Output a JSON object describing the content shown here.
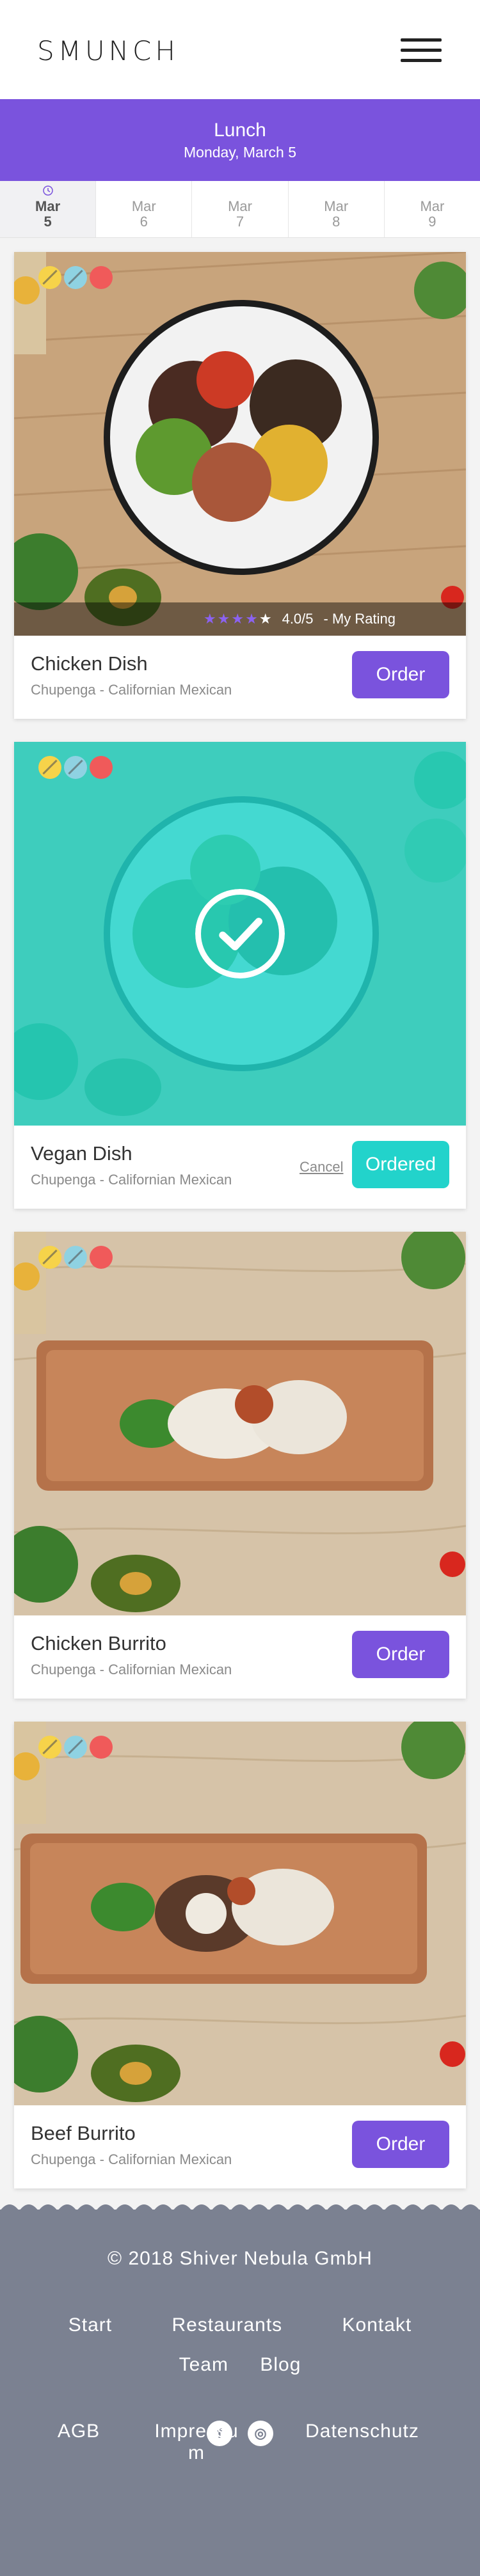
{
  "header": {
    "logo": "SMUNCH",
    "menu_icon": "hamburger-icon"
  },
  "banner": {
    "meal": "Lunch",
    "date": "Monday, March 5"
  },
  "tabs": [
    {
      "month": "Mar",
      "day": "5",
      "active": true
    },
    {
      "month": "Mar",
      "day": "6",
      "active": false
    },
    {
      "month": "Mar",
      "day": "7",
      "active": false
    },
    {
      "month": "Mar",
      "day": "8",
      "active": false
    },
    {
      "month": "Mar",
      "day": "9",
      "active": false
    }
  ],
  "dishes": [
    {
      "name": "Chicken Dish",
      "restaurant": "Chupenga - Californian Mexican",
      "button": "Order",
      "rating": "4.0/5",
      "rating_label": "- My Rating",
      "stars_filled": 4
    },
    {
      "name": "Vegan Dish",
      "restaurant": "Chupenga - Californian Mexican",
      "button": "Ordered",
      "cancel": "Cancel"
    },
    {
      "name": "Chicken Burrito",
      "restaurant": "Chupenga - Californian Mexican",
      "button": "Order"
    },
    {
      "name": "Beef Burrito",
      "restaurant": "Chupenga - Californian Mexican",
      "button": "Order"
    }
  ],
  "footer": {
    "copyright": "© 2018 Shiver Nebula GmbH",
    "nav1": [
      "Start",
      "Restaurants",
      "Kontakt"
    ],
    "nav2": [
      "Team",
      "Blog"
    ],
    "social": [
      "f",
      "◎"
    ],
    "legal": [
      "AGB",
      "Impressum",
      "Datenschutz"
    ]
  },
  "colors": {
    "brand": "#7a53dd",
    "ordered": "#22d3cb",
    "footer": "#7b8191"
  }
}
